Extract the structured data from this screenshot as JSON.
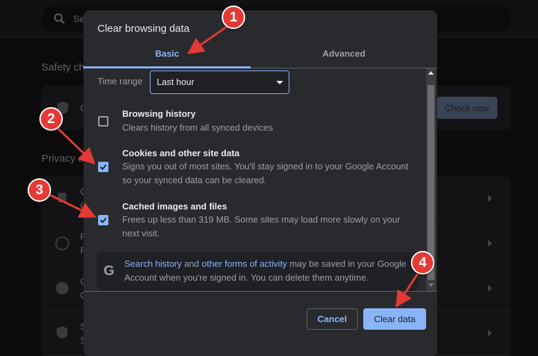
{
  "background": {
    "search_placeholder": "Se",
    "safety_heading": "Safety ch",
    "safety_row_label": "C",
    "check_now": "Check now",
    "privacy_heading": "Privacy a",
    "privacy_rows": [
      {
        "icon": "trash-icon",
        "t": "C",
        "s": "C"
      },
      {
        "icon": "compass-icon",
        "t": "F",
        "s": "F"
      },
      {
        "icon": "cookie-icon",
        "t": "C",
        "s": "C"
      },
      {
        "icon": "shield-icon",
        "t": "S",
        "s": "S"
      }
    ]
  },
  "dialog": {
    "title": "Clear browsing data",
    "tabs": [
      {
        "label": "Basic",
        "active": true
      },
      {
        "label": "Advanced",
        "active": false
      }
    ],
    "time_range_label": "Time range",
    "time_range_value": "Last hour",
    "items": [
      {
        "label": "Browsing history",
        "desc": "Clears history from all synced devices",
        "checked": false
      },
      {
        "label": "Cookies and other site data",
        "desc": "Signs you out of most sites. You'll stay signed in to your Google Account so your synced data can be cleared.",
        "checked": true
      },
      {
        "label": "Cached images and files",
        "desc": "Frees up less than 319 MB. Some sites may load more slowly on your next visit.",
        "checked": true
      }
    ],
    "google_notice": {
      "link1": "Search history",
      "mid": " and ",
      "link2": "other forms of activity",
      "rest": " may be saved in your Google Account when you're signed in. You can delete them anytime."
    },
    "cancel": "Cancel",
    "clear": "Clear data"
  },
  "annotations": [
    "1",
    "2",
    "3",
    "4"
  ],
  "colors": {
    "accent": "#8ab4f8",
    "annotation": "#e53935"
  }
}
